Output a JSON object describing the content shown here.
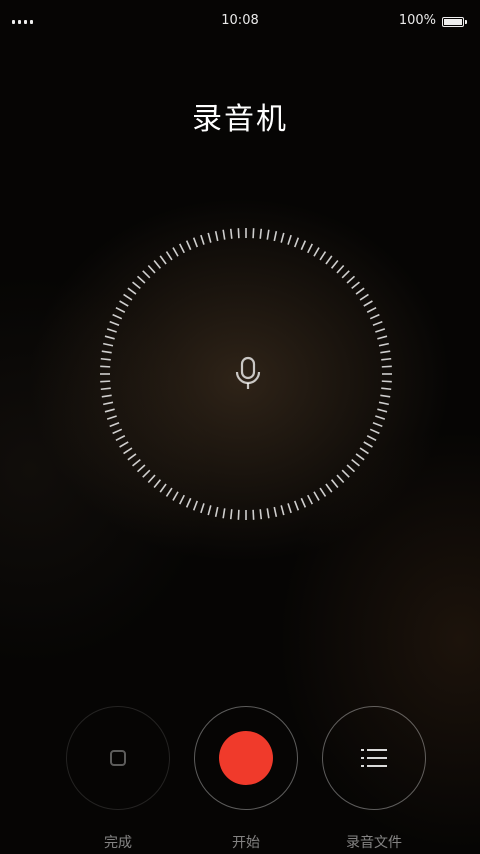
{
  "status_bar": {
    "time": "10:08",
    "battery": "100%",
    "signal_icon": "signal-icon",
    "battery_icon": "battery-icon"
  },
  "header": {
    "title": "录音机"
  },
  "dial": {
    "icon": "microphone-icon"
  },
  "controls": {
    "done_label": "完成",
    "start_label": "开始",
    "files_label": "录音文件",
    "done_icon": "stop-icon",
    "start_icon": "record-icon",
    "files_icon": "list-icon"
  },
  "colors": {
    "record": "#f03a2b",
    "background": "#060504"
  }
}
